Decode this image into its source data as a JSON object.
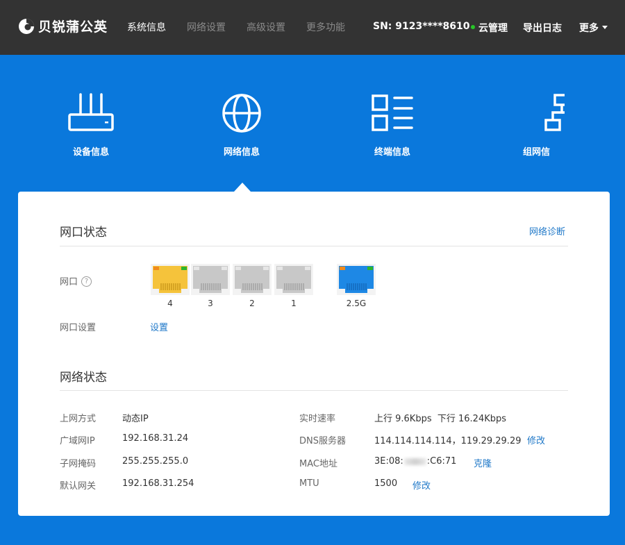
{
  "header": {
    "brand": "贝锐蒲公英",
    "nav": [
      "系统信息",
      "网络设置",
      "高级设置",
      "更多功能"
    ],
    "sn_label": "SN:",
    "sn_value": "9123****8610",
    "cloud": "云管理",
    "export_log": "导出日志",
    "more": "更多"
  },
  "features": [
    {
      "label": "设备信息",
      "icon": "router-icon"
    },
    {
      "label": "网络信息",
      "icon": "globe-icon"
    },
    {
      "label": "终端信息",
      "icon": "list-icon"
    },
    {
      "label": "组网信",
      "icon": "network-topology-icon"
    }
  ],
  "port_section": {
    "title": "网口状态",
    "diagnose": "网络诊断",
    "port_label": "网口",
    "help": "?",
    "ports": [
      {
        "num": "4",
        "state": "active-yellow",
        "color": "#F5C33B"
      },
      {
        "num": "3",
        "state": "inactive",
        "color": "#C8C8C8"
      },
      {
        "num": "2",
        "state": "inactive",
        "color": "#C8C8C8"
      },
      {
        "num": "1",
        "state": "inactive",
        "color": "#C8C8C8"
      },
      {
        "num": "2.5G",
        "state": "active-blue",
        "color": "#1E88E5"
      }
    ],
    "settings_label": "网口设置",
    "settings_link": "设置"
  },
  "network_section": {
    "title": "网络状态",
    "left": [
      {
        "label": "上网方式",
        "value": "动态IP"
      },
      {
        "label": "广域网IP",
        "value": "192.168.31.24"
      },
      {
        "label": "子网掩码",
        "value": "255.255.255.0"
      },
      {
        "label": "默认网关",
        "value": "192.168.31.254"
      }
    ],
    "speed_label": "实时速率",
    "speed_value": "上行 9.6Kbps  下行 16.24Kbps",
    "dns_label": "DNS服务器",
    "dns_value": "114.114.114.114，119.29.29.29",
    "dns_edit": "修改",
    "mac_label": "MAC地址",
    "mac_prefix": "3E:08:",
    "mac_suffix": ":C6:71",
    "mac_clone": "克隆",
    "mtu_label": "MTU",
    "mtu_value": "1500",
    "mtu_edit": "修改"
  },
  "colors": {
    "header_bg": "#333333",
    "page_bg": "#0A78DC",
    "link": "#1F78C8",
    "cloud_dot": "#27C427"
  }
}
